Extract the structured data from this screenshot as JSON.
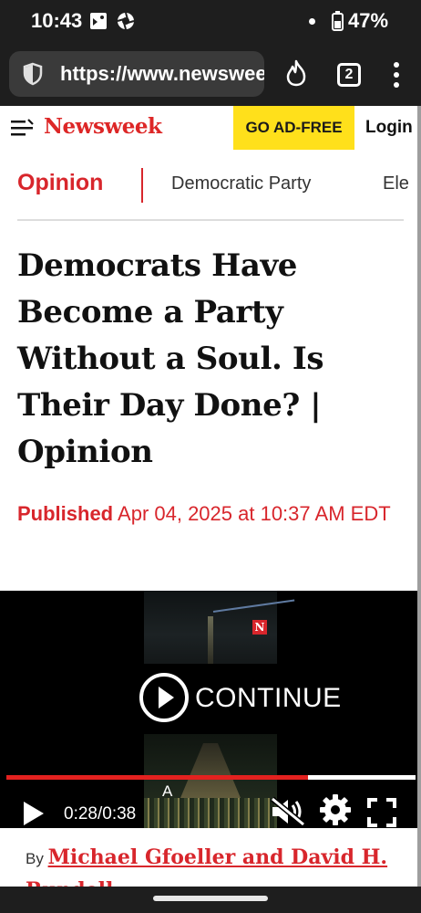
{
  "status_bar": {
    "time": "10:43",
    "battery": "47%"
  },
  "browser": {
    "url": "https://www.newsweek.com",
    "tab_count": "2"
  },
  "site_header": {
    "logo": "Newsweek",
    "ad_free": "GO AD-FREE",
    "login": "Login",
    "brand_color": "#dd2727",
    "ad_free_color": "#ffe01b"
  },
  "section_nav": {
    "primary": "Opinion",
    "links": [
      "Democratic Party",
      "Ele"
    ]
  },
  "article": {
    "headline": "Democrats Have Become a Party Without a Soul. Is Their Day Done? | Opinion",
    "published_label": "Published",
    "published_date": "Apr 04, 2025 at 10:37 AM EDT",
    "byline_prefix": "By",
    "authors": "Michael Gfoeller and David H. Rundell"
  },
  "video": {
    "continue_label": "CONTINUE",
    "badge": "N",
    "caption_mark": "A",
    "current_time": "0:28",
    "duration": "0:38",
    "progress_fraction": 0.737
  },
  "icons": {
    "status": [
      "image-icon",
      "aperture-icon",
      "battery-icon"
    ],
    "browser": [
      "shield-icon",
      "flame-icon",
      "tabs-icon",
      "more-vert-icon"
    ],
    "video": [
      "play-circle-icon",
      "play-icon",
      "mute-icon",
      "settings-icon",
      "fullscreen-icon"
    ]
  }
}
